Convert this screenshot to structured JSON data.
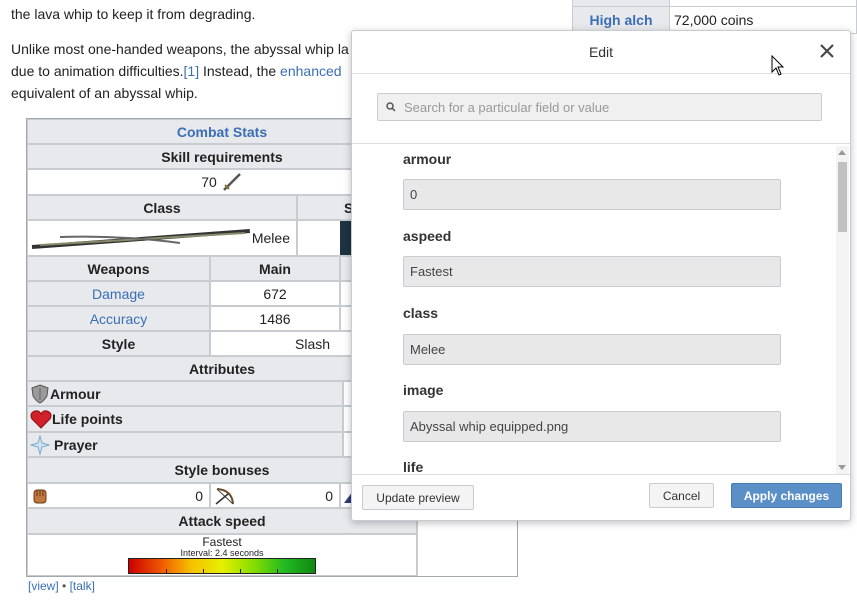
{
  "article": {
    "line1": "the lava whip to keep it from degrading.",
    "line2a": "Unlike most one-handed weapons, the abyssal whip la",
    "line3a": "due to animation difficulties.",
    "ref": "[1]",
    "line3b": " Instead, the ",
    "enhanced": "enhanced",
    "line4": "equivalent of an abyssal whip."
  },
  "infobox": {
    "label": "High alch",
    "value": "72,000 coins"
  },
  "combat": {
    "title": "Combat Stats",
    "skill_req": "Skill requirements",
    "level": "70",
    "class_h": "Class",
    "class_col2": "S",
    "class_val": "Melee",
    "weapons_h": "Weapons",
    "main_h": "Main",
    "damage_l": "Damage",
    "damage_v": "672",
    "accuracy_l": "Accuracy",
    "accuracy_v": "1486",
    "style_l": "Style",
    "style_v": "Slash",
    "attributes_h": "Attributes",
    "armour_l": "Armour",
    "life_l": "Life points",
    "prayer_l": "Prayer",
    "style_bonuses_h": "Style bonuses",
    "sb1": "0",
    "sb2": "0",
    "attack_speed_h": "Attack speed",
    "speed": "Fastest",
    "interval": "Interval: 2.4 seconds",
    "view": "[view]",
    "sep": " • ",
    "talk": "[talk]"
  },
  "modal": {
    "title": "Edit",
    "search_placeholder": "Search for a particular field or value",
    "fields": [
      {
        "label": "armour",
        "value": "0"
      },
      {
        "label": "aspeed",
        "value": "Fastest"
      },
      {
        "label": "class",
        "value": "Melee"
      },
      {
        "label": "image",
        "value": "Abyssal whip equipped.png"
      },
      {
        "label": "life",
        "value": ""
      }
    ],
    "update_preview": "Update preview",
    "cancel": "Cancel",
    "apply": "Apply changes"
  },
  "colors": {
    "link": "#3a6eb5",
    "primary": "#5b8fc7",
    "header_bg": "#e7e9ec"
  }
}
